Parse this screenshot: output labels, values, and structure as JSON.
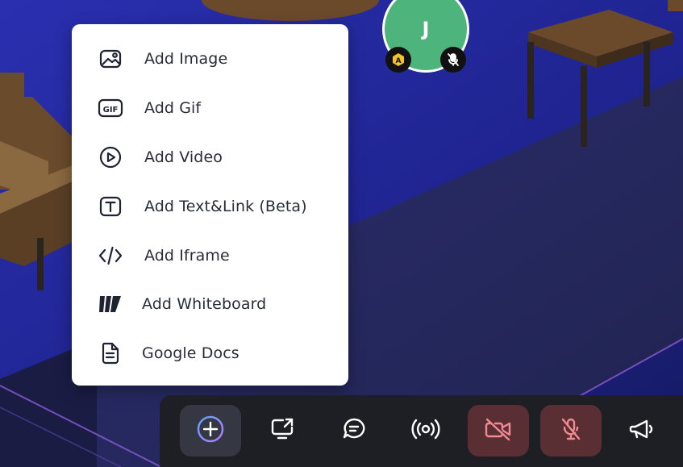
{
  "colors": {
    "floor": "#1b1f6e",
    "avatar_bg": "#4db57c",
    "menu_bg": "#ffffff",
    "toolbar_bg": "#1d1f24",
    "off_button_bg": "#5a2f34",
    "off_icon": "#f28a94"
  },
  "avatar": {
    "initial": "J",
    "badges": [
      "admin-shield-icon",
      "mic-muted-icon"
    ]
  },
  "menu": {
    "items": [
      {
        "label": "Add Image",
        "icon": "image-icon"
      },
      {
        "label": "Add Gif",
        "icon": "gif-icon"
      },
      {
        "label": "Add Video",
        "icon": "play-circle-icon"
      },
      {
        "label": "Add Text&Link (Beta)",
        "icon": "text-box-icon"
      },
      {
        "label": "Add Iframe",
        "icon": "code-icon"
      },
      {
        "label": "Add Whiteboard",
        "icon": "miro-icon"
      },
      {
        "label": "Google Docs",
        "icon": "document-icon"
      }
    ]
  },
  "toolbar": {
    "buttons": [
      {
        "name": "add",
        "icon": "plus-circle-icon",
        "state": "active"
      },
      {
        "name": "share-screen",
        "icon": "screen-share-icon",
        "state": "normal"
      },
      {
        "name": "chat",
        "icon": "chat-icon",
        "state": "normal"
      },
      {
        "name": "broadcast",
        "icon": "broadcast-icon",
        "state": "normal"
      },
      {
        "name": "camera",
        "icon": "camera-off-icon",
        "state": "off"
      },
      {
        "name": "microphone",
        "icon": "mic-off-icon",
        "state": "off"
      },
      {
        "name": "megaphone",
        "icon": "megaphone-icon",
        "state": "normal"
      }
    ]
  }
}
